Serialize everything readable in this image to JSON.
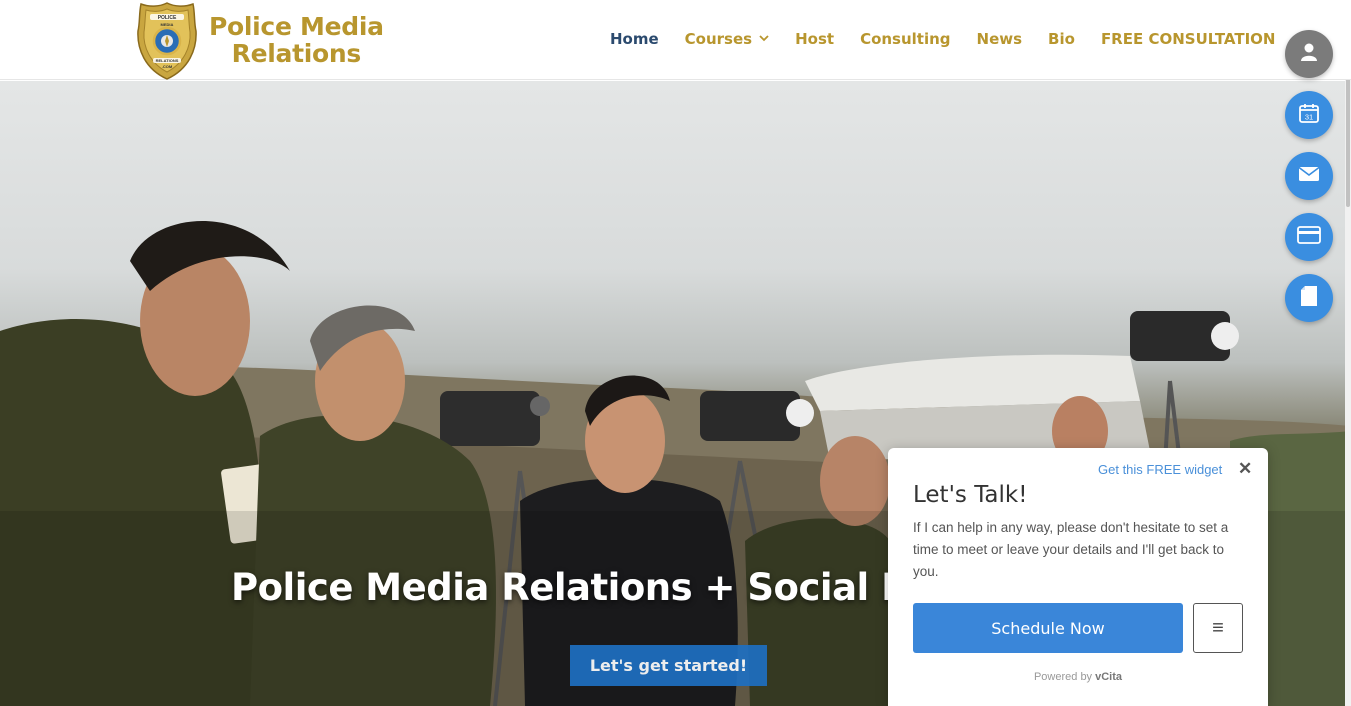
{
  "header": {
    "logo_line1": "Police Media",
    "logo_line2": "Relations",
    "badge_text_top": "POLICE",
    "badge_text_mid": "MEDIA",
    "badge_text_bottom": "RELATIONS",
    "badge_text_com": ".COM"
  },
  "nav": {
    "items": [
      {
        "label": "Home"
      },
      {
        "label": "Courses"
      },
      {
        "label": "Host"
      },
      {
        "label": "Consulting"
      },
      {
        "label": "News"
      },
      {
        "label": "Bio"
      },
      {
        "label": "FREE CONSULTATION"
      }
    ],
    "courses_caret": "⌄"
  },
  "hero": {
    "title": "Police Media Relations + Social Me",
    "cta_label": "Let's get started!"
  },
  "fabs": {
    "calendar_day": "31"
  },
  "widget": {
    "get_widget": "Get this FREE widget",
    "close": "✕",
    "title": "Let's Talk!",
    "text": "If I can help in any way, please don't hesitate to set a time to meet or leave your details and I'll get back to you.",
    "schedule_label": "Schedule Now",
    "menu_icon": "≡",
    "powered_prefix": "Powered by ",
    "powered_brand": "vCita"
  },
  "colors": {
    "brand_gold": "#b8962e",
    "nav_active": "#2b4a6e",
    "accent_blue": "#3a86d9"
  }
}
